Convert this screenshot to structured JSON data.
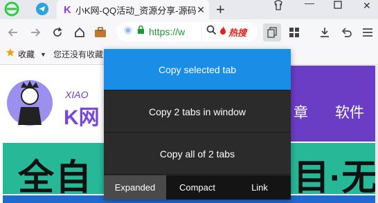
{
  "browser": {
    "tab_title": "小K网-QQ活动_资源分享-源码",
    "url_text": "https://w",
    "search_hot": "热搜",
    "colors": {
      "url_green": "#1a9a2f",
      "hot_red": "#e2231a",
      "accent_blue": "#1a8de6",
      "nav_purple": "#6a3dc4",
      "banner_teal": "#27b897"
    }
  },
  "bookmarks": {
    "label": "收藏",
    "hint": "您还没有收藏"
  },
  "site": {
    "logo_small": "XIAO",
    "logo_big": "K网",
    "nav": [
      "章",
      "软件"
    ],
    "banner_left": "全自",
    "banner_right": "目·无"
  },
  "popup": {
    "items": [
      "Copy selected tab",
      "Copy 2 tabs in window",
      "Copy all of 2 tabs"
    ],
    "tabs": [
      "Expanded",
      "Compact",
      "Link"
    ],
    "active_tab": "Expanded"
  }
}
